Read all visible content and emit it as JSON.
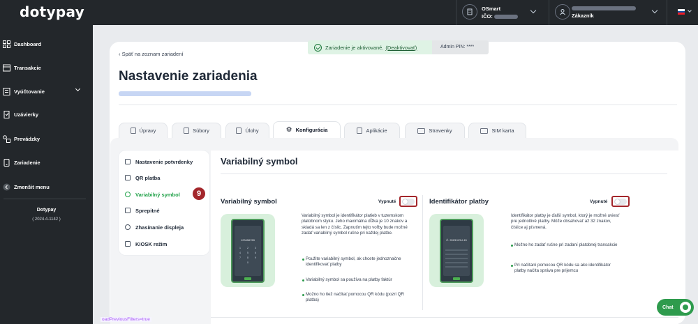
{
  "app": {
    "logo": "dotypay"
  },
  "header": {
    "company_name": "OSmart",
    "ico_label": "IČO:",
    "user_role": "Zákazník",
    "flag_colors": [
      "#ffffff",
      "#0b4ea2",
      "#ee1c25"
    ]
  },
  "sidebar": {
    "items": [
      {
        "label": "Dashboard",
        "icon": "dashboard-icon"
      },
      {
        "label": "Transakcie",
        "icon": "transactions-icon"
      },
      {
        "label": "Vyúčtovanie",
        "icon": "billing-icon"
      },
      {
        "label": "Uzávierky",
        "icon": "closures-icon"
      },
      {
        "label": "Prevádzky",
        "icon": "stores-icon"
      },
      {
        "label": "Zariadenie",
        "icon": "device-icon"
      },
      {
        "label": "Zmenšit menu",
        "icon": "collapse-icon"
      }
    ],
    "version_name": "Dotypay",
    "version_number": "( 2024.4-1142 )"
  },
  "notice": {
    "text": "Zariadenie je aktivované.",
    "link": "(Deaktivovať)",
    "admin_pin": "Admin PIN: ****"
  },
  "page": {
    "back_link": "Späť na zoznam zariadení",
    "title": "Nastavenie zariadenia"
  },
  "tabs": [
    {
      "label": "Úpravy",
      "icon": "edit-icon"
    },
    {
      "label": "Súbory",
      "icon": "files-icon"
    },
    {
      "label": "Úlohy",
      "icon": "tasks-icon"
    },
    {
      "label": "Konfigurácia",
      "icon": "gear-icon",
      "active": true
    },
    {
      "label": "Aplikácie",
      "icon": "apps-icon"
    },
    {
      "label": "Stravenky",
      "icon": "vouchers-icon"
    },
    {
      "label": "SIM karta",
      "icon": "sim-icon"
    }
  ],
  "settings_nav": {
    "items": [
      {
        "label": "Nastavenie potvrdenky",
        "icon": "receipt-icon"
      },
      {
        "label": "QR platba",
        "icon": "qr-icon"
      },
      {
        "label": "Variabilný symbol",
        "icon": "symbol-icon",
        "active": true
      },
      {
        "label": "Sprepitné",
        "icon": "tip-icon"
      },
      {
        "label": "Zhasínanie displeja",
        "icon": "brightness-icon"
      },
      {
        "label": "KIOSK režim",
        "icon": "kiosk-icon"
      }
    ],
    "step_badge": "9"
  },
  "content": {
    "section_title": "Variabilný symbol",
    "left": {
      "title": "Variabilný symbol",
      "switch_label": "Vypnuté",
      "switch_on": false,
      "phone_display": "123456789",
      "keypad": [
        "1",
        "2",
        "3",
        "4",
        "5",
        "6",
        "7",
        "8",
        "9",
        "",
        "0",
        ""
      ],
      "description": "Variabilný symbol je identifikátor platieb v tuzemskom platobnom styku. Jeho maximálna dĺžka je 10 znakov a skladá sa len z číslic. Zapnutím tejto voľby bude možné zadať variabilný symbol ručne pri každej platbe.",
      "bullets": [
        "Použite variabilný symbol, ak chcete jednoznačne identifikovať platby",
        "Variabilný symbol sa používa na platby faktúr",
        "Možno ho tiež načítať pomocou QR kódu (pozri QR platba)"
      ]
    },
    "right": {
      "title": "Identifikátor platby",
      "switch_label": "Vypnuté",
      "switch_on": false,
      "phone_display": "Č. 2023/XOU-15",
      "description": "Identifikátor platby je ďalší symbol, ktorý je možné uviesť pre jednotlivé platby. Môže obsahovať až 32 znakov, číslice aj písmená.",
      "bullets": [
        "Možno ho zadať ručne pri zadaní platobnej transakcie",
        "Pri načítaní pomocou QR kódu sa ako identifikátor platby načíta správa pre prijemcu"
      ]
    }
  },
  "chat": {
    "label": "Chat"
  },
  "url_hint": "oadPreviousFilters=true",
  "colors": {
    "accent_green": "#2e9b4d",
    "highlight_red": "#a3262b",
    "sidebar_bg": "#23272b"
  }
}
